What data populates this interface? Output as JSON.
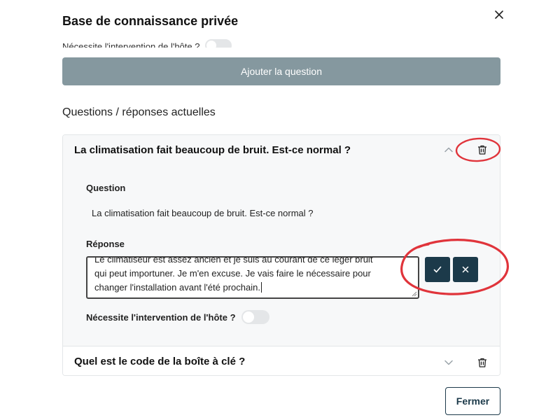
{
  "modal": {
    "title": "Base de connaissance privée",
    "close_icon": "close-icon"
  },
  "top_toggle": {
    "label": "Nécessite l'intervention de l'hôte ?",
    "checked": false
  },
  "add_question_button": "Ajouter la question",
  "section_title": "Questions / réponses actuelles",
  "qa_items": [
    {
      "question": "La climatisation fait beaucoup de bruit. Est-ce normal ?",
      "expanded": true,
      "question_label": "Question",
      "question_text": "La climatisation fait beaucoup de bruit. Est-ce normal ?",
      "answer_label": "Réponse",
      "answer_lines": [
        "Le climatiseur est assez ancien et je suis au courant de ce léger bruit",
        "qui peut importuner. Je m'en excuse. Je vais faire le nécessaire pour",
        "changer l'installation avant l'été prochain."
      ],
      "host_toggle_label": "Nécessite l'intervention de l'hôte ?",
      "host_toggle_checked": false
    },
    {
      "question": "Quel est le code de la boîte à clé ?",
      "expanded": false
    }
  ],
  "footer": {
    "close_button": "Fermer"
  },
  "colors": {
    "primary": "#1c3a4a",
    "disabled_button": "#85989f",
    "annotation": "#e0343b"
  }
}
